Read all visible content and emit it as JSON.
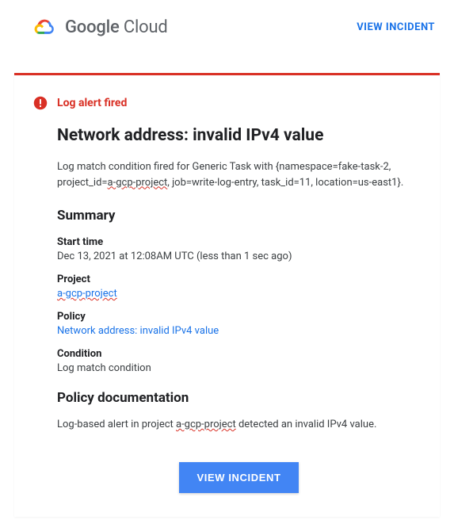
{
  "header": {
    "brand_google": "Google",
    "brand_cloud": " Cloud",
    "view_incident": "VIEW INCIDENT"
  },
  "alert": {
    "label": "Log alert fired"
  },
  "incident": {
    "title": "Network address: invalid IPv4 value",
    "description_prefix": "Log match condition fired for Generic Task with {namespace=fake-task-2, project_id=",
    "description_proj_a": "a-",
    "description_proj_b": "gcp-project",
    "description_suffix": ", job=write-log-entry, task_id=11, location=us-east1}."
  },
  "summary": {
    "heading": "Summary",
    "start_label": "Start time",
    "start_value": "Dec 13, 2021 at 12:08AM UTC (less than 1 sec ago)",
    "project_label": "Project",
    "project_value": "a-gcp-project",
    "policy_label": "Policy",
    "policy_value": "Network address: invalid IPv4 value",
    "condition_label": "Condition",
    "condition_value": "Log match condition"
  },
  "docs": {
    "heading": "Policy documentation",
    "text_prefix": "Log-based alert in project ",
    "text_proj": "a-gcp-project",
    "text_suffix": " detected an invalid IPv4 value."
  },
  "button": {
    "view_incident": "VIEW INCIDENT"
  }
}
